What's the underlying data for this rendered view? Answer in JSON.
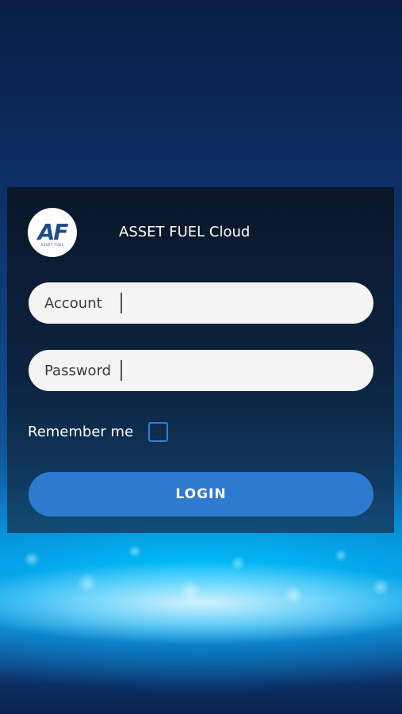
{
  "app": {
    "title": "ASSET FUEL Cloud",
    "logo_text": "AF",
    "logo_subtext": "ASSET FUEL"
  },
  "form": {
    "account": {
      "label": "Account",
      "value": ""
    },
    "password": {
      "label": "Password",
      "value": ""
    },
    "remember_me": {
      "label": "Remember me",
      "checked": false
    },
    "login_label": "LOGIN"
  },
  "colors": {
    "accent": "#2d7ad0",
    "logo_blue": "#1f4e8c",
    "card_background": "#0c1c34",
    "field_background": "#f4f4f4"
  }
}
